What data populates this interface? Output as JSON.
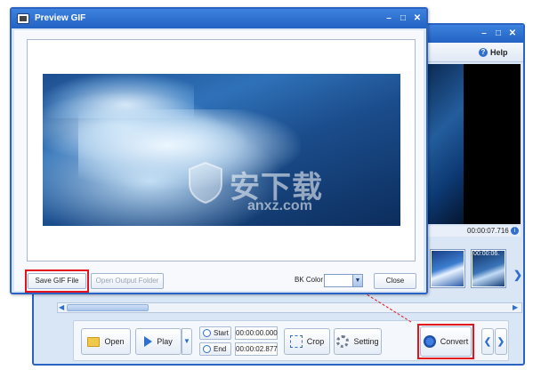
{
  "main_window": {
    "help_label": "Help",
    "time_display": "00:00:07.716",
    "thumb_2_label": "00:00:06.",
    "toolbar": {
      "open_label": "Open",
      "play_label": "Play",
      "start_label": "Start",
      "start_time": "00:00:00.000",
      "end_label": "End",
      "end_time": "00:00:02.877",
      "crop_label": "Crop",
      "setting_label": "Setting",
      "convert_label": "Convert"
    }
  },
  "preview_window": {
    "title": "Preview GIF",
    "save_gif_label": "Save GIF File",
    "open_output_folder_label": "Open Output Folder",
    "bk_color_label": "BK Color",
    "close_label": "Close",
    "watermark_text": "安下载",
    "watermark_url": "anxz.com"
  },
  "colors": {
    "titlebar": "#2a63c4",
    "highlight": "#e3121b",
    "accent": "#2f6fcf"
  }
}
